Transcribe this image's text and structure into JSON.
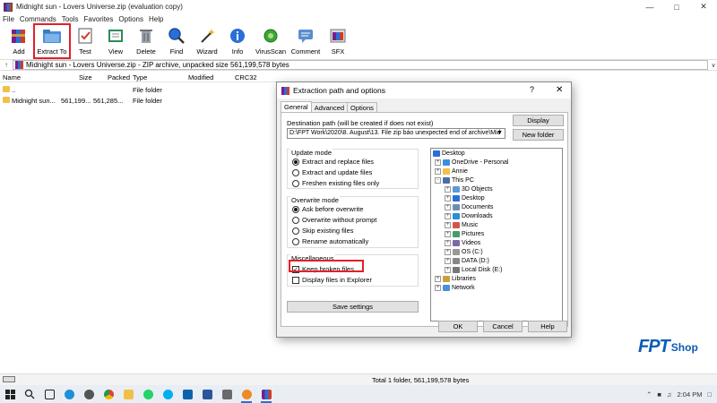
{
  "window": {
    "title": "Midnight sun - Lovers Universe.zip (evaluation copy)"
  },
  "menu": [
    "File",
    "Commands",
    "Tools",
    "Favorites",
    "Options",
    "Help"
  ],
  "toolbar": [
    {
      "label": "Add",
      "icon": "add-icon"
    },
    {
      "label": "Extract To",
      "icon": "extract-to-icon"
    },
    {
      "label": "Test",
      "icon": "test-icon"
    },
    {
      "label": "View",
      "icon": "view-icon"
    },
    {
      "label": "Delete",
      "icon": "delete-icon"
    },
    {
      "label": "Find",
      "icon": "find-icon"
    },
    {
      "label": "Wizard",
      "icon": "wizard-icon"
    },
    {
      "label": "Info",
      "icon": "info-icon"
    },
    {
      "label": "VirusScan",
      "icon": "virusscan-icon"
    },
    {
      "label": "Comment",
      "icon": "comment-icon"
    },
    {
      "label": "SFX",
      "icon": "sfx-icon"
    }
  ],
  "address": {
    "path": "Midnight sun - Lovers Universe.zip - ZIP archive, unpacked size 561,199,578 bytes"
  },
  "filelist": {
    "columns": [
      "Name",
      "Size",
      "Packed",
      "Type",
      "Modified",
      "CRC32"
    ],
    "rows": [
      {
        "name": "..",
        "size": "",
        "packed": "",
        "type": "File folder"
      },
      {
        "name": "Midnight sun...",
        "size": "561,199...",
        "packed": "561,285...",
        "type": "File folder"
      }
    ]
  },
  "status": {
    "total": "Total 1 folder, 561,199,578 bytes"
  },
  "dialog": {
    "title": "Extraction path and options",
    "help_glyph": "?",
    "tabs": [
      "General",
      "Advanced",
      "Options"
    ],
    "dest_label": "Destination path (will be created if does not exist)",
    "dest_value": "D:\\FPT Work\\2020\\8. August\\13. File zip báo unexpected end of archive\\Mid",
    "display_btn": "Display",
    "new_folder_btn": "New folder",
    "update_mode": {
      "title": "Update mode",
      "options": [
        "Extract and replace files",
        "Extract and update files",
        "Freshen existing files only"
      ],
      "selected": 0
    },
    "overwrite_mode": {
      "title": "Overwrite mode",
      "options": [
        "Ask before overwrite",
        "Overwrite without prompt",
        "Skip existing files",
        "Rename automatically"
      ],
      "selected": 0
    },
    "misc": {
      "title": "Miscellaneous",
      "keep_broken": "Keep broken files",
      "keep_broken_checked": true,
      "display_explorer": "Display files in Explorer",
      "display_explorer_checked": false
    },
    "save_settings": "Save settings",
    "tree": [
      {
        "label": "Desktop",
        "level": 0,
        "pm": ""
      },
      {
        "label": "OneDrive - Personal",
        "level": 1,
        "pm": "+"
      },
      {
        "label": "Annie",
        "level": 1,
        "pm": "+"
      },
      {
        "label": "This PC",
        "level": 1,
        "pm": "-"
      },
      {
        "label": "3D Objects",
        "level": 2,
        "pm": "+"
      },
      {
        "label": "Desktop",
        "level": 2,
        "pm": "+"
      },
      {
        "label": "Documents",
        "level": 2,
        "pm": "+"
      },
      {
        "label": "Downloads",
        "level": 2,
        "pm": "+"
      },
      {
        "label": "Music",
        "level": 2,
        "pm": "+"
      },
      {
        "label": "Pictures",
        "level": 2,
        "pm": "+"
      },
      {
        "label": "Videos",
        "level": 2,
        "pm": "+"
      },
      {
        "label": "OS (C:)",
        "level": 2,
        "pm": "+"
      },
      {
        "label": "DATA (D:)",
        "level": 2,
        "pm": "+"
      },
      {
        "label": "Local Disk (E:)",
        "level": 2,
        "pm": "+"
      },
      {
        "label": "Libraries",
        "level": 1,
        "pm": "+"
      },
      {
        "label": "Network",
        "level": 1,
        "pm": "+"
      }
    ],
    "ok": "OK",
    "cancel": "Cancel",
    "help": "Help"
  },
  "logo": {
    "mark": "FPT",
    "word": "Shop"
  },
  "taskbar": {
    "time": "2:04 PM"
  },
  "colors": {
    "highlight": "#e0202a",
    "brand": "#0b5bb5"
  }
}
